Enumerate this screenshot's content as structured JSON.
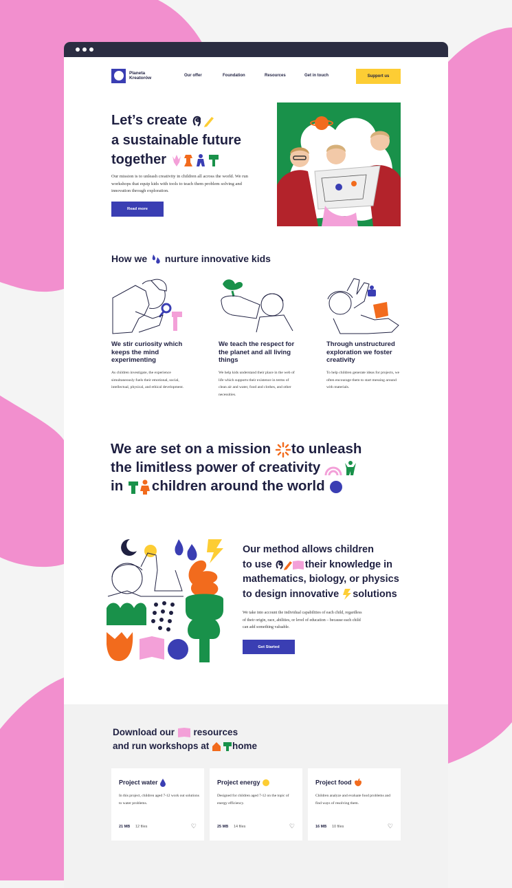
{
  "colors": {
    "pink": "#f28fce",
    "navy": "#2b2d42",
    "blue": "#3a3eb3",
    "yellow": "#fdcd34",
    "green": "#19914a",
    "orange": "#f26b1d",
    "lilac": "#f3a0d8"
  },
  "nav": {
    "brand_line1": "Planeta",
    "brand_line2": "Kreatorów",
    "links": [
      "Our offer",
      "Foundation",
      "Resources",
      "Get in touch"
    ],
    "cta": "Support us"
  },
  "hero": {
    "title_line1": "Let’s create",
    "title_line2": "a sustainable future",
    "title_line3": "together",
    "text": "Our mission is to unleash creativity in children all across the world. We run workshops that equip kids with tools to teach them problem solving and innovation through exploration.",
    "button": "Read more"
  },
  "nurture": {
    "title_pre": "How we",
    "title_post": "nurture innovative kids",
    "cards": [
      {
        "title": "We stir curiosity which keeps the mind experimenting",
        "text": "As children investigate, the experience simultaneously fuels their emotional, social, intellectual, physical, and ethical development."
      },
      {
        "title": "We teach the respect for the planet and all living things",
        "text": "We help kids understand their place in the web of life which supports their existence in terms of clean air and water, food and clothes, and other necessities."
      },
      {
        "title": "Through unstructured exploration we foster creativity",
        "text": "To help children generate ideas for projects, we often encourage them to start messing around with materials."
      }
    ]
  },
  "mission": {
    "line1a": "We are set on a mission",
    "line1b": "to unleash",
    "line2a": "the limitless power",
    "line2b": "of creativity",
    "line3a": "in",
    "line3b": "children around the world"
  },
  "method": {
    "line1": "Our method allows children",
    "line2a": "to use",
    "line2b": "their knowledge in",
    "line3": "mathematics, biology, or physics",
    "line4a": "to design innovative",
    "line4b": "solutions",
    "text": "We take into account the individual capabilities of each child, regardless of their origin, race, abilities, or level of education – because each child can add something valuable.",
    "button": "Get Started"
  },
  "resources": {
    "line1a": "Download our",
    "line1b": "resources",
    "line2a": "and run workshops at",
    "line2b": "home",
    "cards": [
      {
        "title": "Project water",
        "text": "In this project, children aged 7-12 work out solutions to water problems.",
        "size": "21 MB",
        "files": "12 files",
        "icon": "water-drop-icon"
      },
      {
        "title": "Project energy",
        "text": "Designed for children aged 7-12 on the topic of energy efficiency.",
        "size": "25 MB",
        "files": "14 files",
        "icon": "sun-icon"
      },
      {
        "title": "Project food",
        "text": "Children analyze and evaluate food problems and find ways of resolving them.",
        "size": "16 MB",
        "files": "10 files",
        "icon": "fruit-icon"
      }
    ]
  }
}
